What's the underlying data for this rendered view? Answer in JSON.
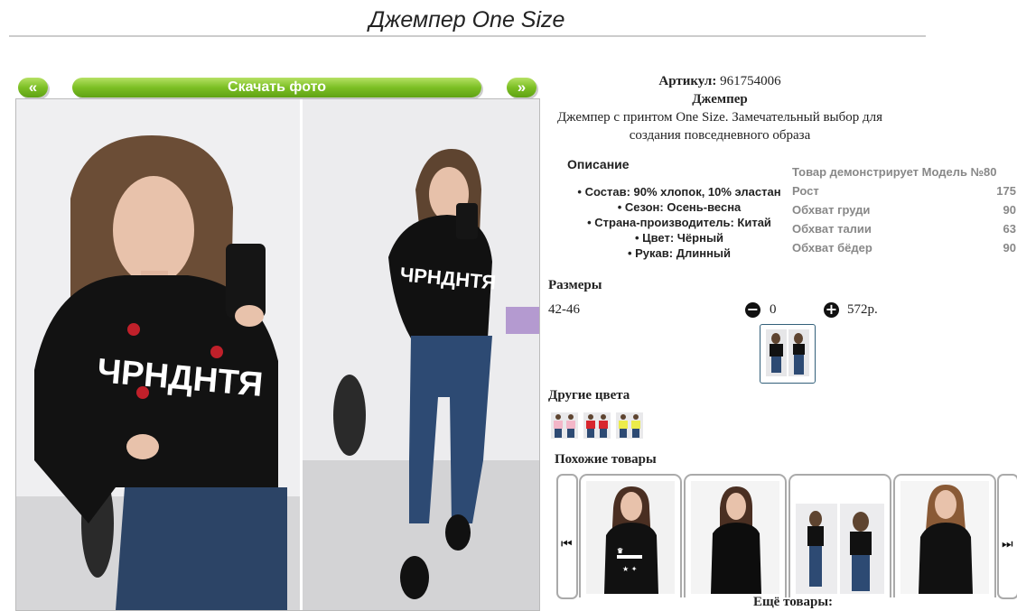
{
  "page": {
    "title": "Джемпер One Size"
  },
  "gallery": {
    "prev_label": "«",
    "next_label": "»",
    "download_label": "Скачать фото",
    "photos": [
      {
        "name": "front-selfie",
        "print_text": "ЧРНДНТЯ"
      },
      {
        "name": "full-length-selfie",
        "print_text": "ЧРНДНТЯ"
      }
    ]
  },
  "product": {
    "article_label": "Артикул:",
    "article_value": "961754006",
    "name": "Джемпер",
    "summary": "Джемпер с принтом One Size. Замечательный выбор для создания повседневного образа"
  },
  "description": {
    "title": "Описание",
    "items": [
      "Состав: 90% хлопок, 10% эластан",
      "Сезон: Осень-весна",
      "Страна-производитель: Китай",
      "Цвет: Чёрный",
      "Рукав: Длинный"
    ]
  },
  "model": {
    "header": "Товар демонстрирует Модель №80",
    "rows": [
      {
        "label": "Рост",
        "value": "175"
      },
      {
        "label": "Обхват груди",
        "value": "90"
      },
      {
        "label": "Обхват талии",
        "value": "63"
      },
      {
        "label": "Обхват бёдер",
        "value": "90"
      }
    ]
  },
  "sizes": {
    "title": "Размеры",
    "size": "42-46",
    "minus_icon": "minus-circle-icon",
    "quantity": "0",
    "plus_icon": "plus-circle-icon",
    "price": "572р."
  },
  "other_colors": {
    "title": "Другие цвета",
    "colors": [
      "#f3b6c8",
      "#d8262e",
      "#ecec4a"
    ]
  },
  "similar": {
    "title": "Похожие товары",
    "prev_icon": "skip-back-icon",
    "next_icon": "skip-forward-icon",
    "prev_glyph": "⏮",
    "next_glyph": "⏭"
  },
  "more_label": "Ещё товары:",
  "colors": {
    "accent_green": "#7cbf24",
    "text": "#222222",
    "muted": "#888888"
  }
}
